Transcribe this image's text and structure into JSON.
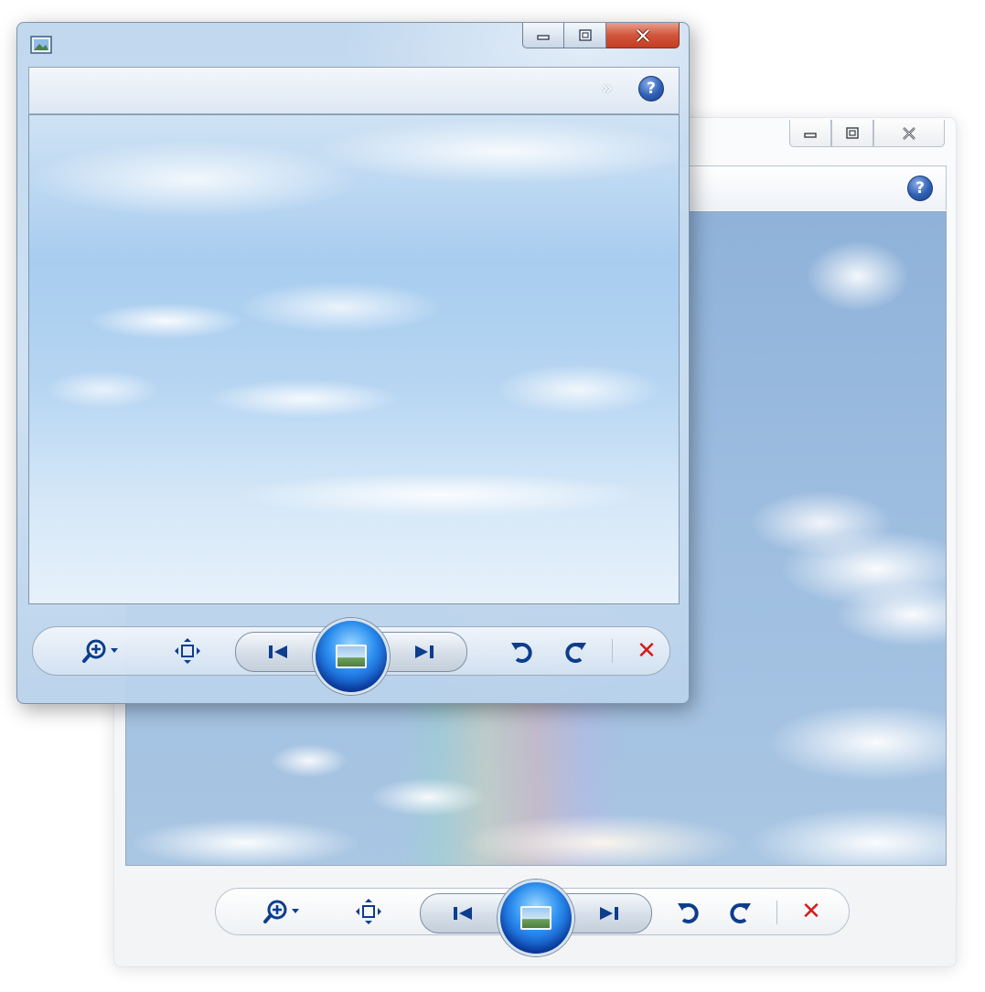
{
  "front_window": {
    "help_label": "?",
    "chevrons_label": "»",
    "caption": {
      "minimize_icon": "minimize-icon",
      "maximize_icon": "maximize-icon",
      "close_icon": "close-icon"
    }
  },
  "back_window": {
    "help_label": "?"
  },
  "toolbar": {
    "zoom_icon": "zoom-in-icon",
    "fit_icon": "actual-size-icon",
    "prev_icon": "previous-icon",
    "slideshow_icon": "slideshow-icon",
    "next_icon": "next-icon",
    "rotate_ccw_icon": "rotate-counterclockwise-icon",
    "rotate_cw_icon": "rotate-clockwise-icon",
    "delete_label": "✕"
  },
  "colors": {
    "accent_blue": "#2d8ff0",
    "close_red": "#c43e22",
    "delete_red": "#d61c1c"
  }
}
